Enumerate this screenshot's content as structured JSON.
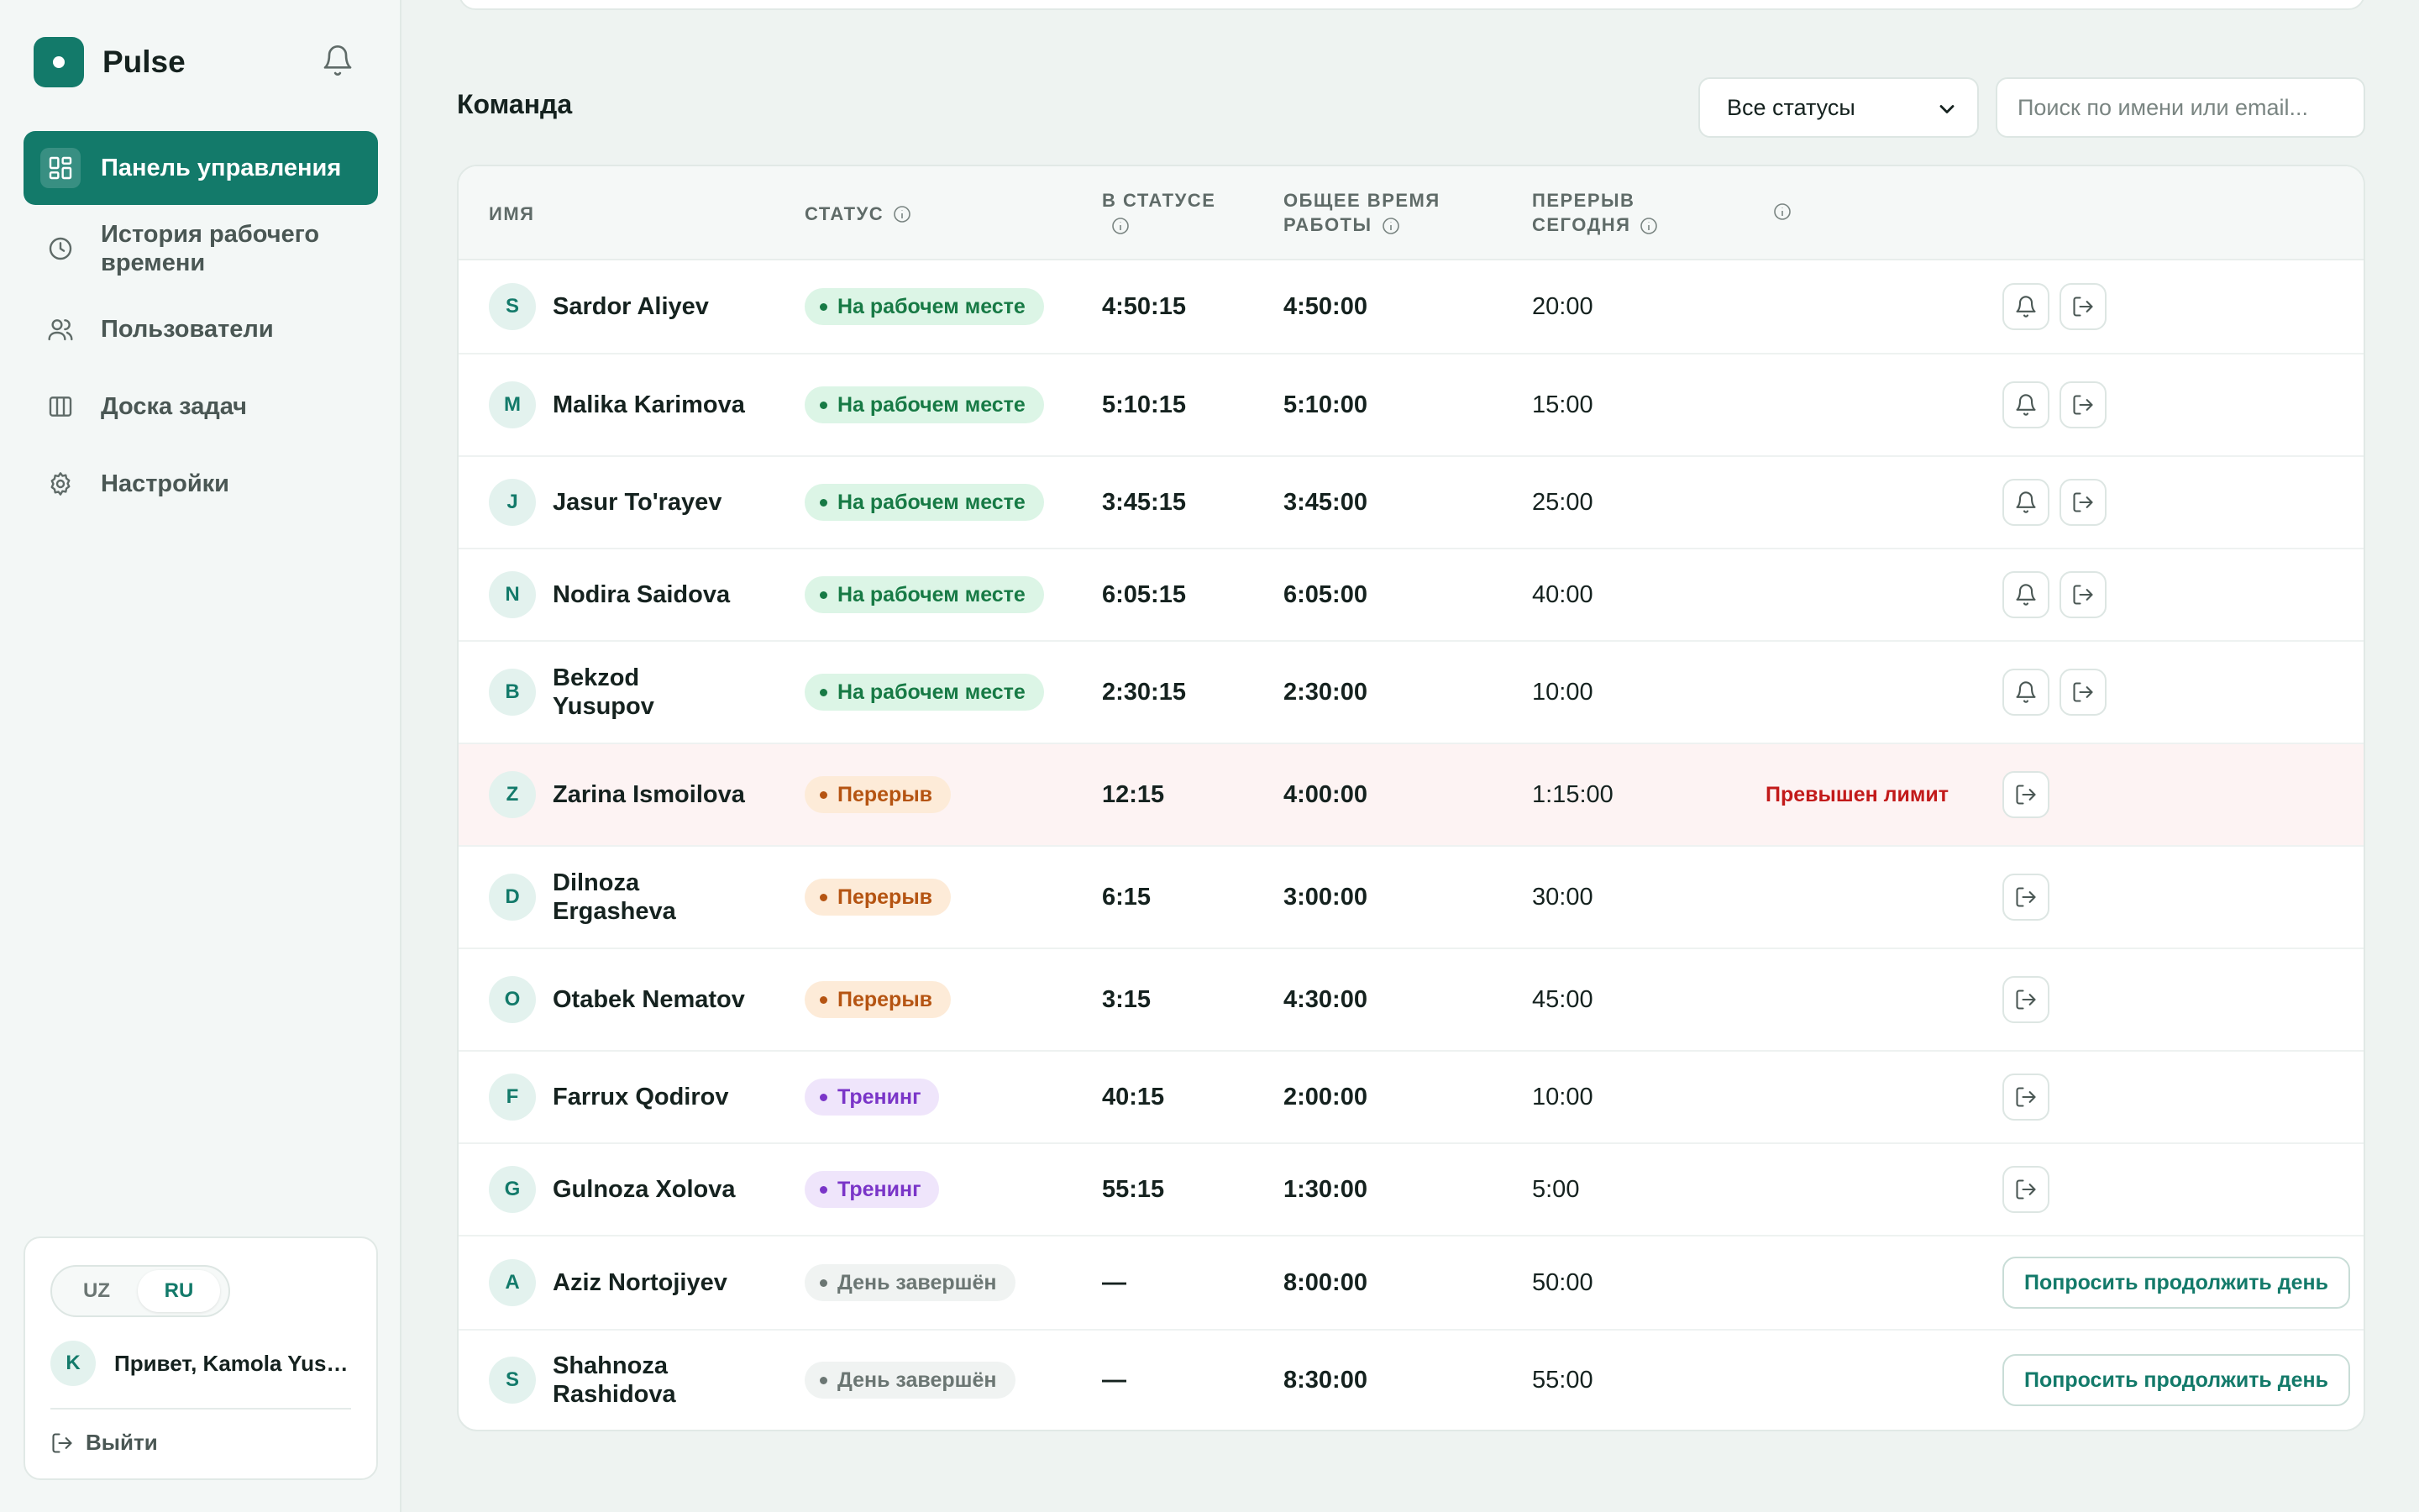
{
  "app": {
    "name": "Pulse"
  },
  "sidebar": {
    "items": [
      {
        "label": "Панель управления",
        "icon": "dashboard-icon",
        "active": true
      },
      {
        "label": "История рабочего времени",
        "icon": "clock-icon",
        "active": false
      },
      {
        "label": "Пользователи",
        "icon": "users-icon",
        "active": false
      },
      {
        "label": "Доска задач",
        "icon": "columns-icon",
        "active": false
      },
      {
        "label": "Настройки",
        "icon": "gear-icon",
        "active": false
      }
    ],
    "languages": [
      "UZ",
      "RU"
    ],
    "active_language": "RU",
    "user_initial": "K",
    "greeting": "Привет, Kamola Yusupova",
    "logout_label": "Выйти"
  },
  "team": {
    "title": "Команда",
    "status_filter": "Все статусы",
    "search_placeholder": "Поиск по имени или email..."
  },
  "table": {
    "headers": {
      "name": "ИМЯ",
      "status": "СТАТУС",
      "in_status": "В СТАТУСЕ",
      "total_time_1": "ОБЩЕЕ ВРЕМЯ",
      "total_time_2": "РАБОТЫ",
      "break_1": "ПЕРЕРЫВ",
      "break_2": "СЕГОДНЯ"
    },
    "rows": [
      {
        "initial": "S",
        "name": "Sardor Aliyev",
        "status": "На рабочем месте",
        "kind": "work",
        "in_status": "4:50:15",
        "total": "4:50:00",
        "break": "20:00",
        "warning": "",
        "actions": "both"
      },
      {
        "initial": "M",
        "name": "Malika Karimova",
        "status": "На рабочем месте",
        "kind": "work",
        "in_status": "5:10:15",
        "total": "5:10:00",
        "break": "15:00",
        "warning": "",
        "actions": "both"
      },
      {
        "initial": "J",
        "name": "Jasur To'rayev",
        "status": "На рабочем месте",
        "kind": "work",
        "in_status": "3:45:15",
        "total": "3:45:00",
        "break": "25:00",
        "warning": "",
        "actions": "both"
      },
      {
        "initial": "N",
        "name": "Nodira Saidova",
        "status": "На рабочем месте",
        "kind": "work",
        "in_status": "6:05:15",
        "total": "6:05:00",
        "break": "40:00",
        "warning": "",
        "actions": "both"
      },
      {
        "initial": "B",
        "name": "Bekzod Yusupov",
        "status": "На рабочем месте",
        "kind": "work",
        "in_status": "2:30:15",
        "total": "2:30:00",
        "break": "10:00",
        "warning": "",
        "actions": "both"
      },
      {
        "initial": "Z",
        "name": "Zarina Ismoilova",
        "status": "Перерыв",
        "kind": "break",
        "in_status": "12:15",
        "total": "4:00:00",
        "break": "1:15:00",
        "warning": "Превышен лимит",
        "actions": "logout"
      },
      {
        "initial": "D",
        "name": "Dilnoza Ergasheva",
        "status": "Перерыв",
        "kind": "break",
        "in_status": "6:15",
        "total": "3:00:00",
        "break": "30:00",
        "warning": "",
        "actions": "logout"
      },
      {
        "initial": "O",
        "name": "Otabek Nematov",
        "status": "Перерыв",
        "kind": "break",
        "in_status": "3:15",
        "total": "4:30:00",
        "break": "45:00",
        "warning": "",
        "actions": "logout"
      },
      {
        "initial": "F",
        "name": "Farrux Qodirov",
        "status": "Тренинг",
        "kind": "train",
        "in_status": "40:15",
        "total": "2:00:00",
        "break": "10:00",
        "warning": "",
        "actions": "logout"
      },
      {
        "initial": "G",
        "name": "Gulnoza Xolova",
        "status": "Тренинг",
        "kind": "train",
        "in_status": "55:15",
        "total": "1:30:00",
        "break": "5:00",
        "warning": "",
        "actions": "logout"
      },
      {
        "initial": "A",
        "name": "Aziz Nortojiyev",
        "status": "День завершён",
        "kind": "done",
        "in_status": "—",
        "total": "8:00:00",
        "break": "50:00",
        "warning": "",
        "actions": "ask",
        "ask_label": "Попросить продолжить день"
      },
      {
        "initial": "S",
        "name": "Shahnoza Rashidova",
        "status": "День завершён",
        "kind": "done",
        "in_status": "—",
        "total": "8:30:00",
        "break": "55:00",
        "warning": "",
        "actions": "ask",
        "ask_label": "Попросить продолжить день"
      }
    ]
  },
  "colors": {
    "accent": "#137a6a",
    "work": "#177a45",
    "break": "#b55412",
    "training": "#7a35c8",
    "done": "#6b7673",
    "alert": "#c21a1a"
  }
}
